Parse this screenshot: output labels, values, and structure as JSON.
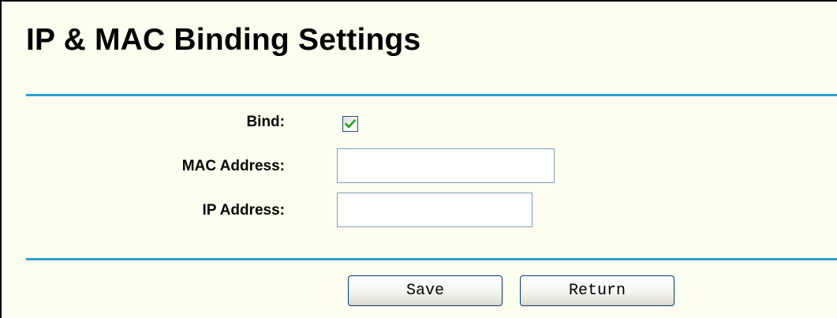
{
  "page": {
    "title": "IP & MAC Binding Settings"
  },
  "form": {
    "bind": {
      "label": "Bind:",
      "checked": true
    },
    "mac_address": {
      "label": "MAC Address:",
      "value": ""
    },
    "ip_address": {
      "label": "IP Address:",
      "value": ""
    }
  },
  "buttons": {
    "save_label": "Save",
    "return_label": "Return"
  },
  "colors": {
    "page_background": "#fefef0",
    "divider": "#2a9fd6",
    "checkmark": "#21a121"
  }
}
